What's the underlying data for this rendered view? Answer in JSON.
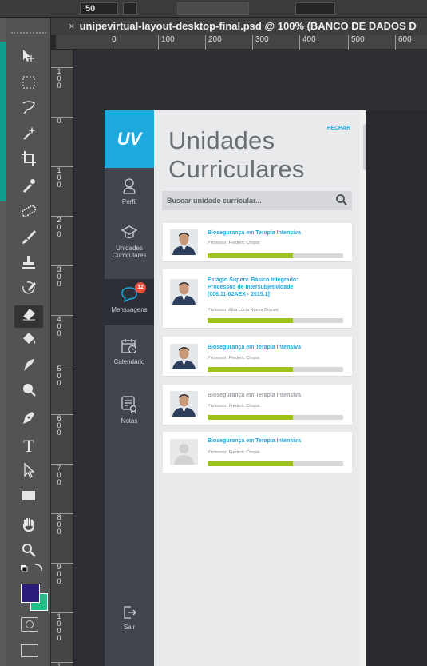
{
  "photoshop": {
    "zoom_field": "50",
    "document_tab": "unipevirtual-layout-desktop-final.psd @ 100% (BANCO DE DADOS D",
    "hruler_ticks": [
      "0",
      "100",
      "200",
      "300",
      "400",
      "500",
      "600"
    ],
    "vruler_ticks": [
      "100",
      "0",
      "100",
      "200",
      "300",
      "400",
      "500",
      "600",
      "700",
      "800",
      "900",
      "1000",
      "1"
    ],
    "tools": [
      "move-icon",
      "marquee-icon",
      "lasso-icon",
      "magic-wand-icon",
      "crop-icon",
      "eyedropper-icon",
      "healing-brush-icon",
      "brush-icon",
      "stamp-icon",
      "history-brush-icon",
      "eraser-icon",
      "paint-bucket-icon",
      "blur-icon",
      "dodge-icon",
      "pen-icon",
      "type-icon",
      "path-select-icon",
      "rectangle-icon",
      "hand-icon",
      "zoom-icon"
    ],
    "fg_color": "#2a1e7a",
    "bg_color": "#1fbf86"
  },
  "app": {
    "logo": "UV",
    "title_line1": "Unidades",
    "title_line2": "Curriculares",
    "close_label": "FECHAR",
    "search_placeholder": "Buscar unidade curricular...",
    "nav": [
      {
        "label": "Perfil",
        "icon": "user-icon"
      },
      {
        "label_line1": "Unidades",
        "label_line2": "Curriculares",
        "icon": "graduation-cap-icon"
      },
      {
        "label": "Menssagens",
        "icon": "chat-icon",
        "badge": "12"
      },
      {
        "label": "Calendário",
        "icon": "calendar-icon"
      },
      {
        "label": "Notas",
        "icon": "grades-icon"
      },
      {
        "label": "Sair",
        "icon": "logout-icon"
      }
    ],
    "cards": [
      {
        "title": "Biosegurança em Terapia Intensiva",
        "professor": "Professor: Frederic Chopin",
        "progress": 0.63
      },
      {
        "title_line1": "Estágio Superv. Básico Integrado:",
        "title_line2": "Processos de Intersubjetividade",
        "title_line3": "[006.11-02AEX - 2015.1]",
        "professor": "Professor: Alba Lúcia Nunes Gomes",
        "progress": 0.63
      },
      {
        "title": "Biosegurança em Terapia Intensiva",
        "professor": "Professor: Frederic Chopin",
        "progress": 0.63
      },
      {
        "title": "Biosegurança em Terapia Intensiva",
        "professor": "Professor: Frederic Chopin",
        "progress": 0.63
      },
      {
        "title": "Biosegurança em Terapia Intensiva",
        "professor": "Professor: Frederic Chopin",
        "progress": 0.63
      }
    ],
    "accent": "#1eaadf",
    "progress_color": "#9ec21d"
  }
}
